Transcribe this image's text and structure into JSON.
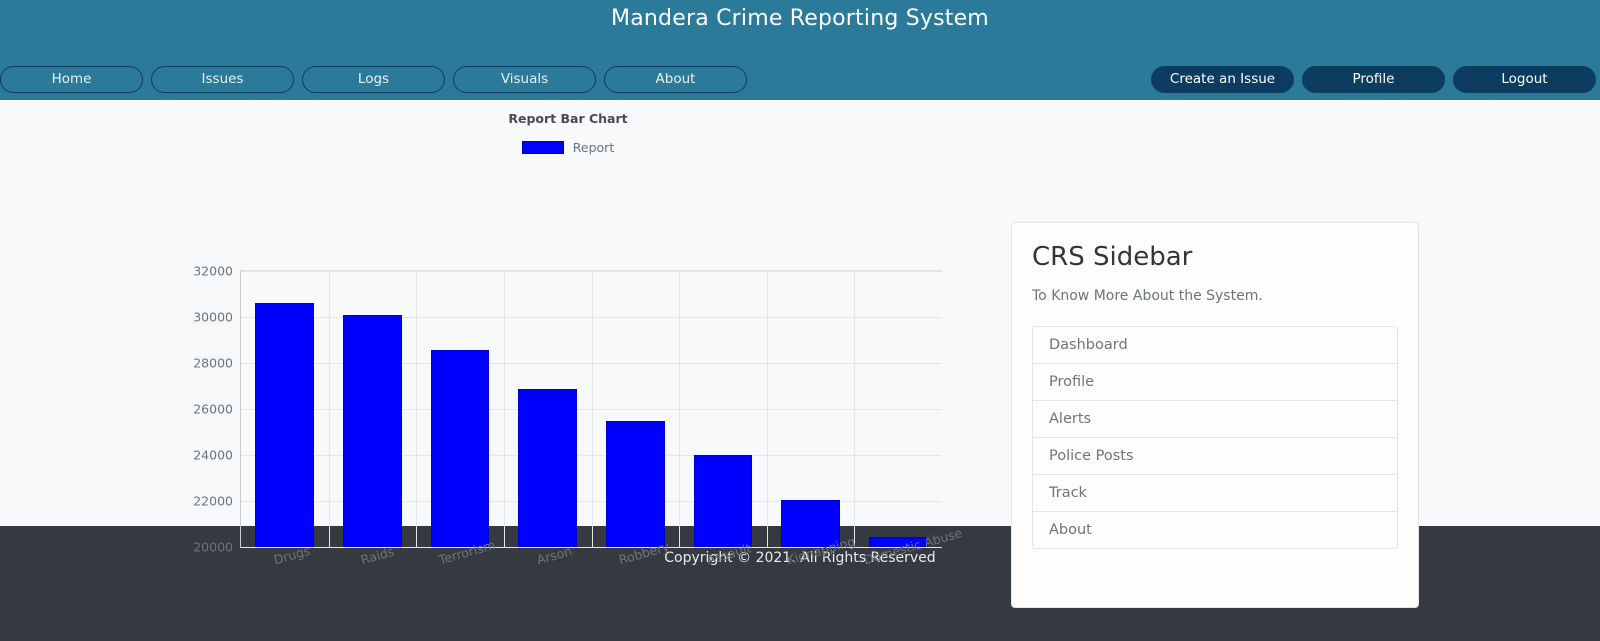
{
  "header": {
    "title": "Mandera Crime Reporting System",
    "brand_color": "#2b7a99",
    "accent_color": "#0d3c61",
    "nav_left": [
      {
        "label": "Home",
        "name": "home"
      },
      {
        "label": "Issues",
        "name": "issues"
      },
      {
        "label": "Logs",
        "name": "logs"
      },
      {
        "label": "Visuals",
        "name": "visuals"
      },
      {
        "label": "About",
        "name": "about"
      }
    ],
    "nav_right": [
      {
        "label": "Create an Issue",
        "name": "create"
      },
      {
        "label": "Profile",
        "name": "profile"
      },
      {
        "label": "Logout",
        "name": "logout"
      }
    ]
  },
  "chart_data": {
    "type": "bar",
    "title": "Report Bar Chart",
    "xlabel": "",
    "ylabel": "",
    "grid": true,
    "legend_position": "top",
    "legend": [
      "Report"
    ],
    "series_color": "#0000ff",
    "ylim": [
      20000,
      32000
    ],
    "yticks": [
      20000,
      22000,
      24000,
      26000,
      28000,
      30000,
      32000
    ],
    "categories": [
      "Drugs",
      "Raids",
      "Terrorism",
      "Arson",
      "Robbery",
      "Assault",
      "Kidnapping",
      "Domestic Abuse"
    ],
    "series": [
      {
        "name": "Report",
        "values": [
          30600,
          30100,
          28550,
          26870,
          25480,
          23990,
          22050,
          20450
        ]
      }
    ]
  },
  "sidebar": {
    "title": "CRS Sidebar",
    "subtitle": "To Know More About the System.",
    "items": [
      {
        "label": "Dashboard",
        "name": "dashboard"
      },
      {
        "label": "Profile",
        "name": "profile"
      },
      {
        "label": "Alerts",
        "name": "alerts"
      },
      {
        "label": "Police Posts",
        "name": "police-posts"
      },
      {
        "label": "Track",
        "name": "track"
      },
      {
        "label": "About",
        "name": "about"
      }
    ]
  },
  "footer": {
    "text": "Copyright © 2021. All Rights Reserved"
  }
}
